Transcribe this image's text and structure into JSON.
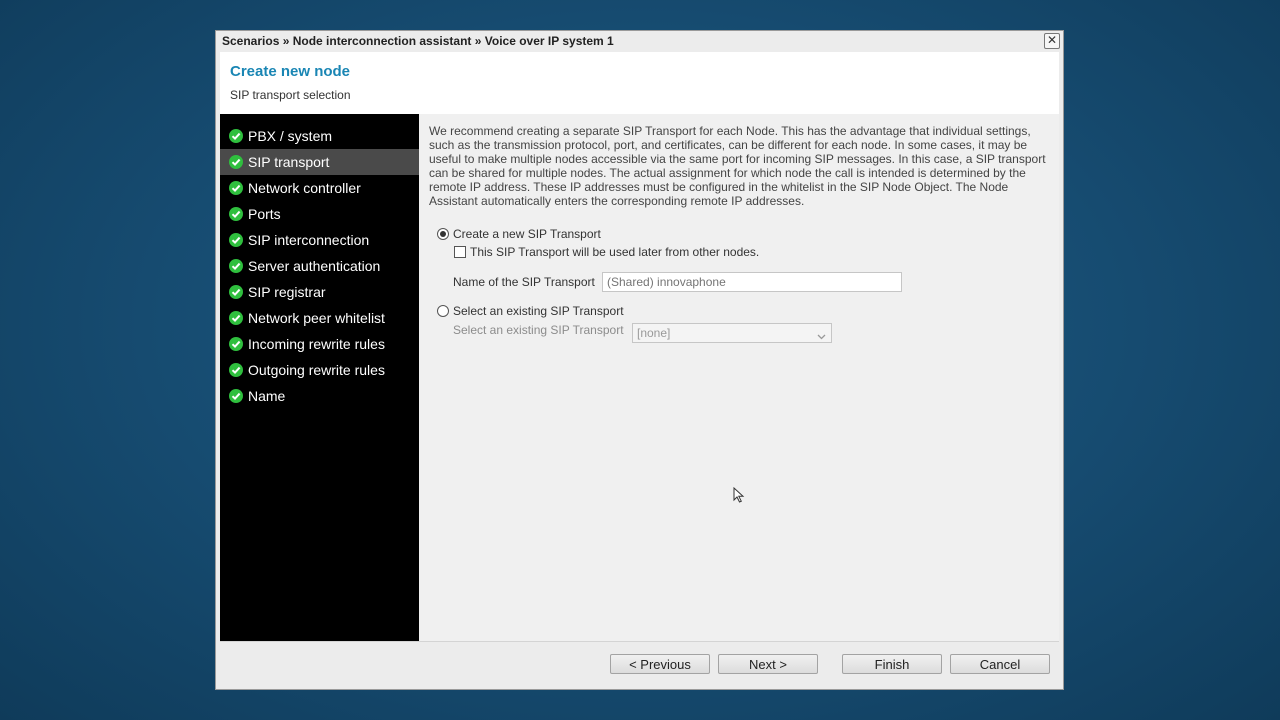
{
  "titlebar": {
    "breadcrumb": "Scenarios » Node interconnection assistant » Voice over IP system 1",
    "close_label": "✕"
  },
  "header": {
    "title": "Create new node",
    "subtitle": "SIP transport selection"
  },
  "sidebar": {
    "items": [
      {
        "label": "PBX / system",
        "active": false
      },
      {
        "label": "SIP transport",
        "active": true
      },
      {
        "label": "Network controller",
        "active": false
      },
      {
        "label": "Ports",
        "active": false
      },
      {
        "label": "SIP interconnection",
        "active": false
      },
      {
        "label": "Server authentication",
        "active": false
      },
      {
        "label": "SIP registrar",
        "active": false
      },
      {
        "label": "Network peer whitelist",
        "active": false
      },
      {
        "label": "Incoming rewrite rules",
        "active": false
      },
      {
        "label": "Outgoing rewrite rules",
        "active": false
      },
      {
        "label": "Name",
        "active": false
      }
    ],
    "item_icon": "check-circle-icon"
  },
  "content": {
    "description": "We recommend creating a separate SIP Transport for each Node. This has the advantage that individual settings, such as the transmission protocol, port, and certificates, can be different for each node. In some cases, it may be useful to make multiple nodes accessible via the same port for incoming SIP messages. In this case, a SIP transport can be shared for multiple nodes. The actual assignment for which node the call is intended is determined by the remote IP address. These IP addresses must be configured in the whitelist in the SIP Node Object. The Node Assistant automatically enters the corresponding remote IP addresses.",
    "option_new": {
      "label": "Create a new SIP Transport",
      "selected": true,
      "shared_checkbox_label": "This SIP Transport will be used later from other nodes.",
      "shared_checked": false,
      "name_label": "Name of the SIP Transport",
      "name_placeholder": "(Shared) innovaphone"
    },
    "option_existing": {
      "label": "Select an existing SIP Transport",
      "selected": false,
      "select_label": "Select an existing SIP Transport",
      "select_value": "[none]"
    }
  },
  "footer": {
    "previous": "< Previous",
    "next": "Next >",
    "finish": "Finish",
    "cancel": "Cancel"
  },
  "colors": {
    "accent": "#1a86b4",
    "check_green": "#2fbf3e",
    "sidebar_bg": "#000000",
    "sidebar_active": "#4a4a4a"
  }
}
